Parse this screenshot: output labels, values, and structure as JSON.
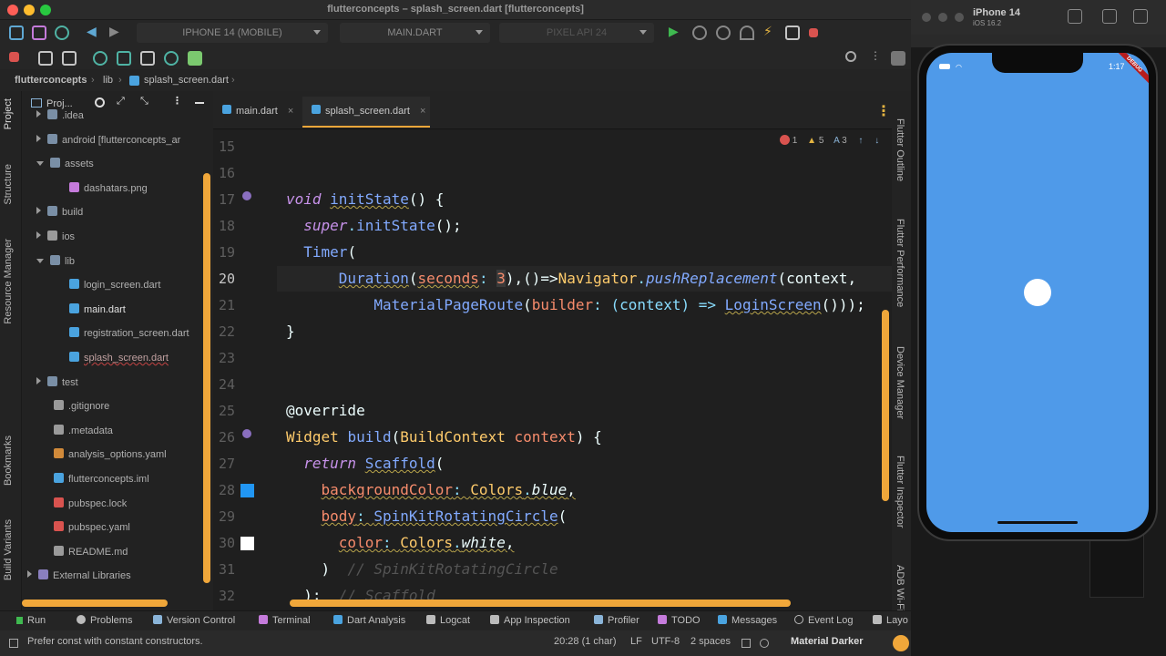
{
  "window": {
    "title": "flutterconcepts – splash_screen.dart [flutterconcepts]"
  },
  "toolbar": {
    "device_select": "IPHONE 14 (MOBILE)",
    "config_select": "MAIN.DART",
    "emulator_select": "PIXEL API 24"
  },
  "breadcrumb": [
    "flutterconcepts",
    "lib",
    "splash_screen.dart"
  ],
  "left_strip": [
    "Project",
    "Structure",
    "Resource Manager",
    "Bookmarks",
    "Build Variants"
  ],
  "project": {
    "header": "Proj...",
    "items": [
      {
        "label": ".idea",
        "depth": 1,
        "kind": "folder",
        "arrow": "right"
      },
      {
        "label": "android [flutterconcepts_ar",
        "depth": 1,
        "kind": "folder",
        "arrow": "right"
      },
      {
        "label": "assets",
        "depth": 1,
        "kind": "folder",
        "arrow": "down"
      },
      {
        "label": "dashatars.png",
        "depth": 2,
        "kind": "image"
      },
      {
        "label": "build",
        "depth": 1,
        "kind": "folder",
        "arrow": "right"
      },
      {
        "label": "ios",
        "depth": 1,
        "kind": "tools",
        "arrow": "right"
      },
      {
        "label": "lib",
        "depth": 1,
        "kind": "folder",
        "arrow": "down"
      },
      {
        "label": "login_screen.dart",
        "depth": 2,
        "kind": "dart"
      },
      {
        "label": "main.dart",
        "depth": 2,
        "kind": "dart"
      },
      {
        "label": "registration_screen.dart",
        "depth": 2,
        "kind": "dart"
      },
      {
        "label": "splash_screen.dart",
        "depth": 2,
        "kind": "dart"
      },
      {
        "label": "test",
        "depth": 1,
        "kind": "folder",
        "arrow": "right"
      },
      {
        "label": ".gitignore",
        "depth": 1,
        "kind": "file"
      },
      {
        "label": ".metadata",
        "depth": 1,
        "kind": "file"
      },
      {
        "label": "analysis_options.yaml",
        "depth": 1,
        "kind": "yaml"
      },
      {
        "label": "flutterconcepts.iml",
        "depth": 1,
        "kind": "iml"
      },
      {
        "label": "pubspec.lock",
        "depth": 1,
        "kind": "lock"
      },
      {
        "label": "pubspec.yaml",
        "depth": 1,
        "kind": "lock"
      },
      {
        "label": "README.md",
        "depth": 1,
        "kind": "md"
      },
      {
        "label": "External Libraries",
        "depth": 0,
        "kind": "lib",
        "arrow": "right"
      }
    ]
  },
  "tabs": [
    {
      "label": "main.dart",
      "active": false
    },
    {
      "label": "splash_screen.dart",
      "active": true
    }
  ],
  "inspections": {
    "errors": "1",
    "warnings": "5",
    "typos": "3"
  },
  "line_numbers": [
    "15",
    "16",
    "17",
    "18",
    "19",
    "20",
    "21",
    "22",
    "23",
    "24",
    "25",
    "26",
    "27",
    "28",
    "29",
    "30",
    "31",
    "32"
  ],
  "code": {
    "l17_void": "void",
    "l17_name": "initState",
    "l17_rest": "() {",
    "l18_super": "super",
    "l18_call": "initState",
    "l18_rest": "();",
    "l19_timer": "Timer",
    "l19_rest": "(",
    "l20_dur": "Duration",
    "l20_param": "seconds",
    "l20_colon": ": ",
    "l20_num": "3",
    "l20_arrow": "),()=>",
    "l20_nav": "Navigator",
    "l20_dot": ".",
    "l20_push": "pushReplacement",
    "l20_ctx": "(context,",
    "l21_route": "MaterialPageRoute",
    "l21_open": "(",
    "l21_builder": "builder",
    "l21_mid": ": (context) => ",
    "l21_login": "LoginScreen",
    "l21_close": "()));",
    "l22": "}",
    "l25": "@override",
    "l26_widget": "Widget",
    "l26_build": "build",
    "l26_open": "(",
    "l26_bc": "BuildContext",
    "l26_ctx": " context",
    "l26_close": ") {",
    "l27_return": "return",
    "l27_scaffold": "Scaffold",
    "l27_open": "(",
    "l28_prop": "backgroundColor",
    "l28_colon": ": ",
    "l28_colors": "Colors",
    "l28_dot": ".",
    "l28_val": "blue",
    "l28_comma": ",",
    "l29_prop": "body",
    "l29_colon": ": ",
    "l29_spin": "SpinKitRotatingCircle",
    "l29_open": "(",
    "l30_prop": "color",
    "l30_colon": ": ",
    "l30_colors": "Colors",
    "l30_dot": ".",
    "l30_val": "white",
    "l30_comma": ",",
    "l31_close": ")",
    "l31_comment": "// SpinKitRotatingCircle",
    "l32_close": ");",
    "l32_comment": "// Scaffold"
  },
  "right_strip": [
    "Flutter Outline",
    "Flutter Performance",
    "Device Manager",
    "Flutter Inspector",
    "ADB Wi-Fi"
  ],
  "bottom_tools": [
    "Run",
    "Problems",
    "Version Control",
    "Terminal",
    "Dart Analysis",
    "Logcat",
    "App Inspection",
    "Profiler",
    "TODO",
    "Messages",
    "Event Log",
    "Layo"
  ],
  "status": {
    "message": "Prefer const with constant constructors.",
    "position": "20:28 (1 char)",
    "line_sep": "LF",
    "encoding": "UTF-8",
    "indent": "2 spaces",
    "theme": "Material Darker"
  },
  "simulator": {
    "device": "iPhone 14",
    "os": "iOS 16.2",
    "time": "1:17",
    "banner": "DEBUG"
  },
  "colors": {
    "accent": "#f0a73a",
    "screen_bg": "#4f9ae9",
    "spinner": "#ffffff"
  }
}
